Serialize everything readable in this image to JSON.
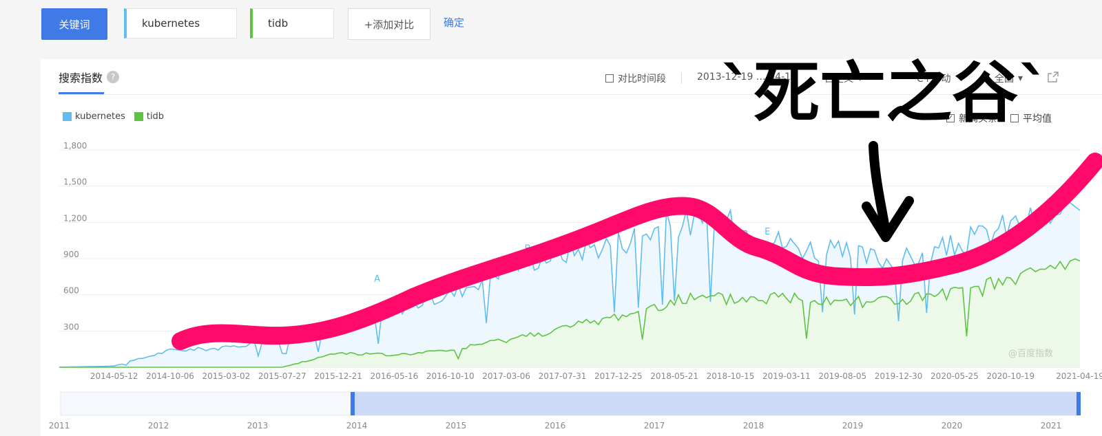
{
  "toolbar": {
    "keyword_button": "关键词",
    "keywords": [
      "kubernetes",
      "tidb"
    ],
    "add_compare": "+添加对比",
    "confirm": "确定"
  },
  "panel": {
    "title": "搜索指数",
    "help_icon": "?",
    "compare_period_label": "对比时间段",
    "date_range_visible": "2013-12-19 … 04-19",
    "custom_label": "自定义",
    "device_label": "C+移动",
    "region_label": "全国",
    "news_label": "新闻头条",
    "news_checked": true,
    "average_label": "平均值",
    "average_checked": false,
    "watermark": "@百度指数"
  },
  "colors": {
    "accent": "#3f7ae6",
    "kubernetes": "#5fbdf0",
    "tidb": "#5ec440",
    "kubernetes_fill": "#eef7fd",
    "tidb_fill": "#ecf8e8",
    "annotation_stroke": "#ff0a6a"
  },
  "chart_data": {
    "type": "line",
    "ylim": [
      0,
      1800
    ],
    "y_ticks": [
      1800,
      1500,
      1200,
      900,
      600,
      300
    ],
    "y_tick_labels": [
      "1,800",
      "1,500",
      "1,200",
      "900",
      "600",
      "300"
    ],
    "x_labels": [
      "2014-05-12",
      "2014-10-06",
      "2015-03-02",
      "2015-07-27",
      "2015-12-21",
      "2016-05-16",
      "2016-10-10",
      "2017-03-06",
      "2017-07-31",
      "2017-12-25",
      "2018-05-21",
      "2018-10-15",
      "2019-03-11",
      "2019-08-05",
      "2019-12-30",
      "2020-05-25",
      "2020-10-19",
      "2021-04-19"
    ],
    "legend": [
      "kubernetes",
      "tidb"
    ],
    "series": [
      {
        "name": "kubernetes",
        "x": [
          "2013-12-19",
          "2014-05-12",
          "2014-10-06",
          "2015-03-02",
          "2015-07-27",
          "2015-12-21",
          "2016-05-16",
          "2016-10-10",
          "2017-03-06",
          "2017-07-31",
          "2017-12-25",
          "2018-05-21",
          "2018-10-15",
          "2019-03-11",
          "2019-08-05",
          "2019-12-30",
          "2020-05-25",
          "2020-10-19",
          "2021-04-19"
        ],
        "values": [
          0,
          10,
          140,
          160,
          250,
          350,
          480,
          600,
          840,
          950,
          1040,
          1200,
          1180,
          1020,
          940,
          880,
          1000,
          1180,
          1300
        ]
      },
      {
        "name": "tidb",
        "x": [
          "2013-12-19",
          "2014-05-12",
          "2014-10-06",
          "2015-03-02",
          "2015-07-27",
          "2015-12-21",
          "2016-05-16",
          "2016-10-10",
          "2017-03-06",
          "2017-07-31",
          "2017-12-25",
          "2018-05-21",
          "2018-10-15",
          "2019-03-11",
          "2019-08-05",
          "2019-12-30",
          "2020-05-25",
          "2020-10-19",
          "2021-04-19"
        ],
        "values": [
          0,
          0,
          0,
          0,
          0,
          120,
          100,
          140,
          230,
          320,
          420,
          560,
          560,
          580,
          560,
          550,
          600,
          720,
          880
        ]
      }
    ],
    "annotations": [
      "A",
      "B",
      "E"
    ],
    "range_slider_years": [
      "2011",
      "2012",
      "2013",
      "2014",
      "2015",
      "2016",
      "2017",
      "2018",
      "2019",
      "2020",
      "2021"
    ]
  },
  "handwriting": {
    "text": "`死亡之谷`",
    "arrow": "↓"
  }
}
